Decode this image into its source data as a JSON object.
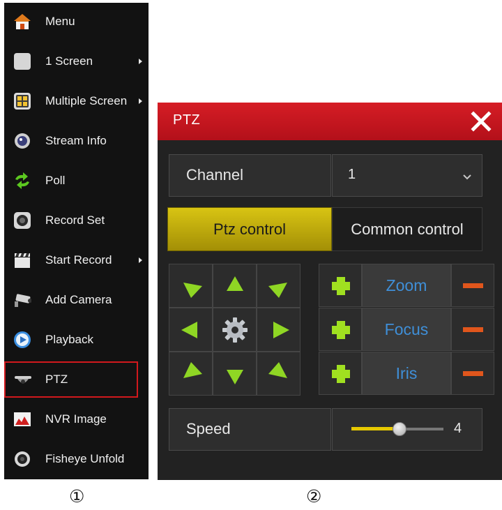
{
  "menu": {
    "items": [
      {
        "label": "Menu",
        "icon": "house-icon",
        "submenu": false
      },
      {
        "label": "1 Screen",
        "icon": "single-screen-icon",
        "submenu": true
      },
      {
        "label": "Multiple Screen",
        "icon": "multi-screen-icon",
        "submenu": true
      },
      {
        "label": "Stream Info",
        "icon": "stream-info-icon",
        "submenu": false
      },
      {
        "label": "Poll",
        "icon": "poll-icon",
        "submenu": false
      },
      {
        "label": "Record Set",
        "icon": "record-set-icon",
        "submenu": false
      },
      {
        "label": "Start Record",
        "icon": "clapperboard-icon",
        "submenu": true
      },
      {
        "label": "Add Camera",
        "icon": "camera-icon",
        "submenu": false
      },
      {
        "label": "Playback",
        "icon": "playback-icon",
        "submenu": false
      },
      {
        "label": "PTZ",
        "icon": "dome-camera-icon",
        "submenu": false,
        "highlighted": true
      },
      {
        "label": "NVR Image",
        "icon": "nvr-image-icon",
        "submenu": false
      },
      {
        "label": "Fisheye Unfold",
        "icon": "fisheye-icon",
        "submenu": false
      }
    ]
  },
  "dialog": {
    "title": "PTZ",
    "close_icon": "close-icon",
    "channel": {
      "label": "Channel",
      "value": "1"
    },
    "tabs": [
      {
        "label": "Ptz control",
        "active": true
      },
      {
        "label": "Common control",
        "active": false
      }
    ],
    "lens": [
      {
        "label": "Zoom"
      },
      {
        "label": "Focus"
      },
      {
        "label": "Iris"
      }
    ],
    "speed": {
      "label": "Speed",
      "value": "4",
      "level_fraction": 0.5
    }
  },
  "captions": [
    "①",
    "②"
  ],
  "colors": {
    "header_red": "#c8141c",
    "active_tab_yellow": "#c9b40d",
    "arrow_green": "#8fd624",
    "lens_label_blue": "#3f8fd8",
    "minus_orange": "#e0561c",
    "highlight_border": "#d2191d"
  }
}
